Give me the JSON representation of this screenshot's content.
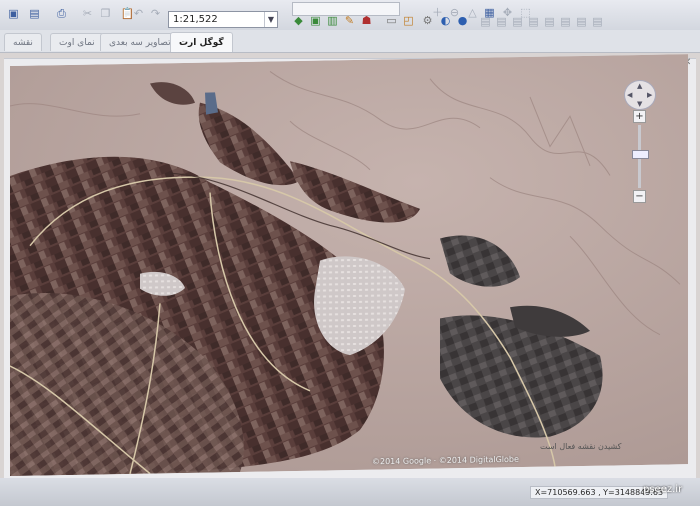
{
  "toolbar": {
    "scale_value": "1:21,522",
    "icons": [
      "save-icon",
      "save-as-icon",
      "print-icon",
      "cut-icon",
      "copy-icon",
      "paste-icon",
      "undo-icon",
      "redo-icon"
    ]
  },
  "tabs": [
    {
      "label": "نقشه",
      "active": false
    },
    {
      "label": "نمای اوت",
      "active": false
    },
    {
      "label": "تصاویر سه بعدی",
      "active": false
    },
    {
      "label": "گوگل ارت",
      "active": true
    }
  ],
  "map": {
    "attribution": "©2014 Google · ©2014 DigitalGlobe"
  },
  "status": {
    "left_text": "کشیدن نقشه فعال است",
    "coords": "X=710569.663 , Y=3148849.63"
  },
  "watermark": "pseez.ir"
}
